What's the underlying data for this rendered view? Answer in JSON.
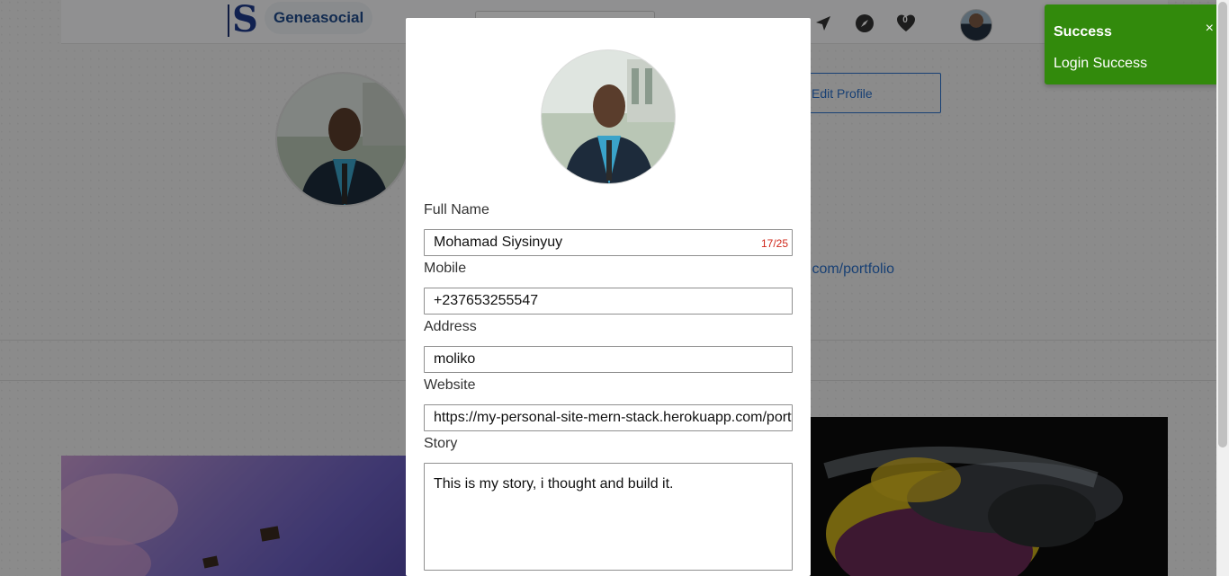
{
  "navbar": {
    "brand": "Geneasocial",
    "notification_count": "0"
  },
  "profile": {
    "edit_button": "Edit Profile",
    "website_partial": ".com/portfolio"
  },
  "modal": {
    "fields": {
      "fullname_label": "Full Name",
      "fullname_value": "Mohamad Siysinyuy",
      "fullname_count": "17/25",
      "mobile_label": "Mobile",
      "mobile_value": "+237653255547",
      "address_label": "Address",
      "address_value": "moliko",
      "website_label": "Website",
      "website_value": "https://my-personal-site-mern-stack.herokuapp.com/portfolio",
      "story_label": "Story",
      "story_value": "This is my story, i thought and build it."
    }
  },
  "toast": {
    "title": "Success",
    "close": "×",
    "message": "Login Success",
    "color": "#328a0c"
  },
  "icons": [
    "send-icon",
    "explore-icon",
    "heart-icon",
    "close-icon"
  ]
}
